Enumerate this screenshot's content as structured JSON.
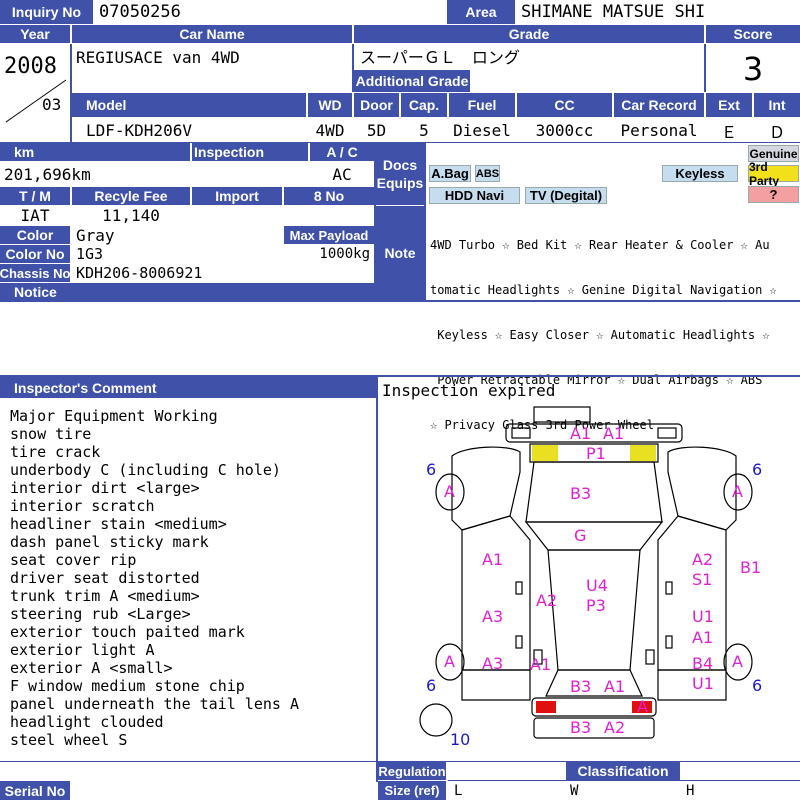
{
  "header": {
    "inquiry_label": "Inquiry No",
    "inquiry_value": "07050256",
    "area_label": "Area",
    "area_value": "SHIMANE MATSUE SHI"
  },
  "row1": {
    "year_label": "Year",
    "car_name_label": "Car Name",
    "grade_label": "Grade",
    "score_label": "Score",
    "year_value": "2008",
    "month_value": "03",
    "car_name_value": "REGIUSACE van 4WD",
    "grade_value": "スーパーＧＬ　ロング",
    "additional_grade_label": "Additional Grade",
    "score_value": "3"
  },
  "row2": {
    "model_label": "Model",
    "wd_label": "WD",
    "door_label": "Door",
    "cap_label": "Cap.",
    "fuel_label": "Fuel",
    "cc_label": "CC",
    "car_record_label": "Car Record",
    "ext_label": "Ext",
    "int_label": "Int",
    "model_value": "LDF-KDH206V",
    "wd_value": "4WD",
    "door_value": "5D",
    "cap_value": "5",
    "fuel_value": "Diesel",
    "cc_value": "3000cc",
    "car_record_value": "Personal",
    "ext_value": "Ｅ",
    "int_value": "Ｄ"
  },
  "specs": {
    "km_label": "km",
    "inspection_label": "Inspection",
    "ac_label": "A / C",
    "km_value": "201,696km",
    "ac_value": "AC",
    "tm_label": "T / M",
    "recycle_label": "Recyle Fee",
    "import_label": "Import",
    "eightno_label": "8 No",
    "tm_value": "IAT",
    "recycle_value": "11,140",
    "color_label": "Color",
    "color_value": "Gray",
    "maxpayload_label": "Max Payload",
    "colorno_label": "Color No",
    "colorno_value": "1G3",
    "payload_value": "1000kg",
    "chassis_label": "Chassis No",
    "chassis_value": "KDH206-8006921",
    "notice_label": "Notice"
  },
  "docs": {
    "label_line1": "Docs",
    "label_line2": "Equips",
    "abag": "A.Bag",
    "abs": "ABS",
    "keyless": "Keyless",
    "genuine": "Genuine",
    "third_party": "3rd Party",
    "question": "?",
    "hdd_navi": "HDD Navi",
    "tv": "TV (Degital)"
  },
  "note": {
    "label": "Note",
    "lines": [
      "4WD Turbo ☆ Bed Kit ☆ Rear Heater & Cooler ☆ Au",
      "tomatic Headlights ☆ Genine Digital Navigation ☆",
      " Keyless ☆ Easy Closer ☆ Automatic Headlights ☆",
      " Power Retractable Mirror ☆ Dual Airbags ☆ ABS",
      "☆ Privacy Glass 3rd Power Wheel"
    ]
  },
  "inspector": {
    "label": "Inspector's Comment",
    "lines": [
      "Major Equipment Working",
      "snow tire",
      "tire crack",
      "underbody C (including C hole)",
      "interior dirt <large>",
      "interior scratch",
      "headliner stain <medium>",
      "dash panel sticky mark",
      "seat cover rip",
      "driver seat distorted",
      "trunk trim A <medium>",
      "steering rub <Large>",
      "exterior touch paited mark",
      "exterior light A",
      "exterior A <small>",
      "F window medium stone chip",
      "panel underneath the tail lens A",
      "headlight clouded",
      "steel wheel S"
    ]
  },
  "diagram": {
    "status": "Inspection expired",
    "marks": {
      "front_a1a": "A1",
      "front_a1b": "A1",
      "p1": "P1",
      "b3_hood": "B3",
      "g": "G",
      "u4": "U4",
      "p3": "P3",
      "a2_center": "A2",
      "a1_left": "A1",
      "a3_left": "A3",
      "a3_left_low": "A3",
      "a1_left_low": "A1",
      "a2_right": "A2",
      "s1": "S1",
      "b1": "B1",
      "u1_right": "U1",
      "a1_right": "A1",
      "b4": "B4",
      "u1_right_low": "U1",
      "b3_rear": "B3",
      "a1_rear": "A1",
      "a_rearlight": "A",
      "b3_bottom": "B3",
      "a2_bottom": "A2",
      "tire_fl": "A",
      "tire_fr": "A",
      "tire_rl": "A",
      "tire_rr": "A",
      "tread_fl": "6",
      "tread_fr": "6",
      "tread_rl": "6",
      "tread_rr": "6",
      "spare": "10"
    }
  },
  "footer": {
    "serial_label": "Serial No",
    "regulation_label": "Regulation",
    "size_label": "Size (ref)",
    "classification_label": "Classification",
    "l": "L",
    "w": "W",
    "h": "H"
  },
  "colors": {
    "header_bg": "#3f51a8",
    "damage_mark": "#e020d0",
    "tread_number": "#1a1acc",
    "highlight_yellow": "#e8e020",
    "highlight_red": "#e01010"
  }
}
